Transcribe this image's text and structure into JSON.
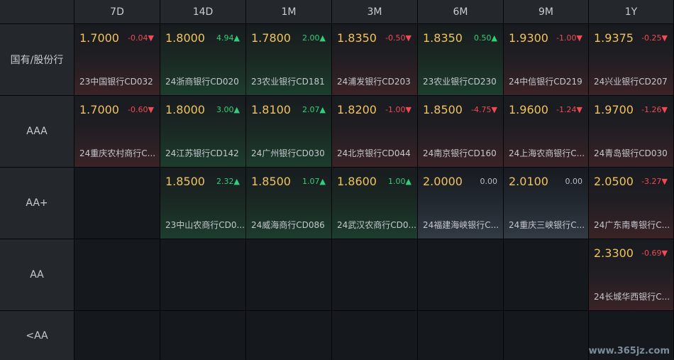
{
  "headers": [
    "7D",
    "14D",
    "1M",
    "3M",
    "6M",
    "9M",
    "1Y"
  ],
  "rows": [
    {
      "label": "国有/股份行",
      "cells": [
        {
          "value": "1.7000",
          "change": "-0.04▼",
          "dir": "neg",
          "name": "23中国银行CD032"
        },
        {
          "value": "1.8000",
          "change": "4.94▲",
          "dir": "pos",
          "name": "24浙商银行CD020"
        },
        {
          "value": "1.7800",
          "change": "2.00▲",
          "dir": "pos",
          "name": "23农业银行CD181"
        },
        {
          "value": "1.8350",
          "change": "-0.50▼",
          "dir": "neg",
          "name": "24浦发银行CD203"
        },
        {
          "value": "1.8350",
          "change": "0.50▲",
          "dir": "pos",
          "name": "23农业银行CD230"
        },
        {
          "value": "1.9300",
          "change": "-1.00▼",
          "dir": "neg",
          "name": "24中信银行CD219"
        },
        {
          "value": "1.9375",
          "change": "-0.25▼",
          "dir": "neg",
          "name": "24兴业银行CD207"
        }
      ]
    },
    {
      "label": "AAA",
      "cells": [
        {
          "value": "1.7000",
          "change": "-0.60▼",
          "dir": "neg",
          "name": "24重庆农村商行C..."
        },
        {
          "value": "1.8000",
          "change": "3.00▲",
          "dir": "pos",
          "name": "24江苏银行CD142"
        },
        {
          "value": "1.8100",
          "change": "2.07▲",
          "dir": "pos",
          "name": "24广州银行CD030"
        },
        {
          "value": "1.8200",
          "change": "-1.00▼",
          "dir": "neg",
          "name": "24北京银行CD044"
        },
        {
          "value": "1.8500",
          "change": "-4.75▼",
          "dir": "neg",
          "name": "24南京银行CD160"
        },
        {
          "value": "1.9600",
          "change": "-1.24▼",
          "dir": "neg",
          "name": "24上海农商银行C..."
        },
        {
          "value": "1.9700",
          "change": "-1.26▼",
          "dir": "neg",
          "name": "24青岛银行CD030"
        }
      ]
    },
    {
      "label": "AA+",
      "cells": [
        null,
        {
          "value": "1.8500",
          "change": "2.32▲",
          "dir": "pos",
          "name": "23中山农商行CD0..."
        },
        {
          "value": "1.8500",
          "change": "1.07▲",
          "dir": "pos",
          "name": "24威海商行CD086"
        },
        {
          "value": "1.8600",
          "change": "1.00▲",
          "dir": "pos",
          "name": "24武汉农商行CD0..."
        },
        {
          "value": "2.0000",
          "change": "0.00",
          "dir": "zero",
          "name": "24福建海峡银行C..."
        },
        {
          "value": "2.0100",
          "change": "0.00",
          "dir": "zero",
          "name": "24重庆三峡银行C..."
        },
        {
          "value": "2.0500",
          "change": "-3.27▼",
          "dir": "neg",
          "name": "24广东南粤银行C..."
        }
      ]
    },
    {
      "label": "AA",
      "cells": [
        null,
        null,
        null,
        null,
        null,
        null,
        {
          "value": "2.3300",
          "change": "-0.69▼",
          "dir": "neg",
          "name": "24长城华西银行C..."
        }
      ]
    },
    {
      "label": "<AA",
      "cells": [
        null,
        null,
        null,
        null,
        null,
        null,
        null
      ]
    }
  ],
  "watermark": "www.365jz.com"
}
